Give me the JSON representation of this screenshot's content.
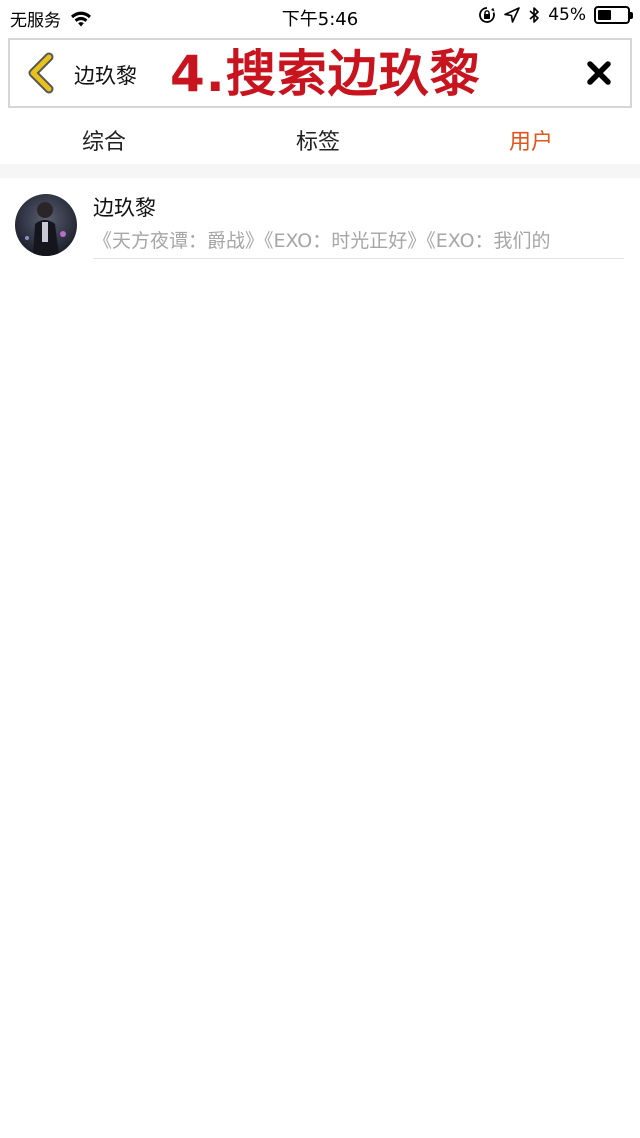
{
  "status_bar": {
    "carrier": "无服务",
    "time": "下午5:46",
    "battery_percent": "45%",
    "battery_level": 0.45,
    "icons": [
      "wifi-icon",
      "orientation-lock-icon",
      "location-icon",
      "bluetooth-icon",
      "battery-icon"
    ]
  },
  "search": {
    "query": "边玖黎",
    "overlay_caption": "4.搜索边玖黎",
    "back_icon": "chevron-left-icon",
    "clear_icon": "close-icon"
  },
  "tabs": [
    {
      "label": "综合",
      "active": false
    },
    {
      "label": "标签",
      "active": false
    },
    {
      "label": "用户",
      "active": true
    }
  ],
  "results": [
    {
      "name": "边玖黎",
      "description": "《天方夜谭：爵战》《EXO：时光正好》《EXO：我们的"
    }
  ],
  "colors": {
    "accent": "#e0571e",
    "caption": "#c8141e",
    "back_chevron": "#e8c21a",
    "secondary_text": "#a6a6a6"
  }
}
